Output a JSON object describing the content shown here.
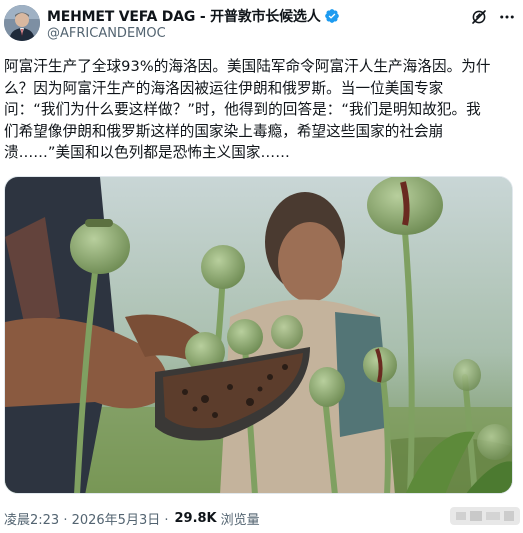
{
  "author": {
    "display_name": "MEHMET VEFA DAG - 开普敦市长候选人",
    "handle": "@AFRICANDEMOC",
    "verified": true,
    "avatar_icon": "profile-photo"
  },
  "header_actions": {
    "grok_icon": "grok-icon",
    "more_icon": "more-icon"
  },
  "tweet": {
    "lines": [
      "阿富汗生产了全球93%的海洛因。美国陆军命令阿富汗人生产海洛因。为什",
      "么？因为阿富汗生产的海洛因被运往伊朗和俄罗斯。当一位美国专家",
      "问：“我们为什么要这样做？”时，他得到的回答是：“我们是明知故犯。我",
      "们希望像伊朗和俄罗斯这样的国家染上毒瘾，希望这些国家的社会崩",
      "溃……”美国和以色列都是恐怖主义国家……"
    ]
  },
  "media": {
    "type": "photo",
    "subject": "poppy-field-harvest-photo"
  },
  "meta": {
    "time_date": "凌晨2:23 · 2026年5月3日 ·",
    "views_count": "29.8K",
    "views_label": "浏览量"
  },
  "colors": {
    "text_primary": "#0f1419",
    "text_secondary": "#536471",
    "verified_blue": "#1d9bf0"
  }
}
